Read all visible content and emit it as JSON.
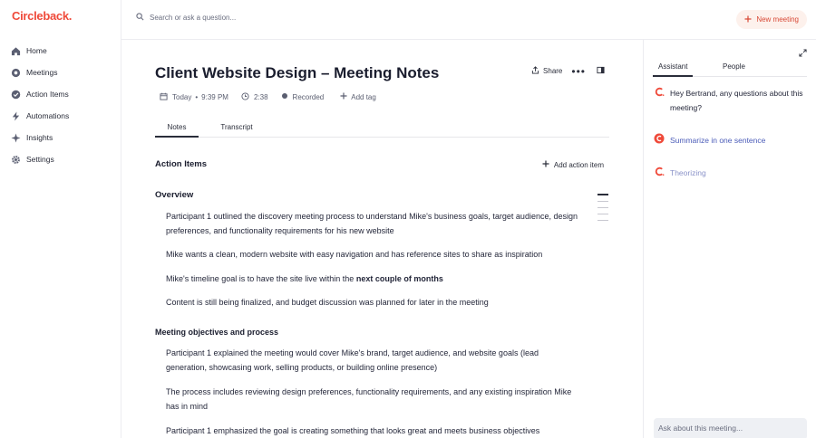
{
  "app": {
    "logo_text": "Circleback",
    "logo_dot": "."
  },
  "sidebar": {
    "items": [
      {
        "icon": "home-icon",
        "label": "Home"
      },
      {
        "icon": "meetings-icon",
        "label": "Meetings"
      },
      {
        "icon": "check-circle-icon",
        "label": "Action Items"
      },
      {
        "icon": "lightning-icon",
        "label": "Automations"
      },
      {
        "icon": "sparkle-icon",
        "label": "Insights"
      },
      {
        "icon": "gear-icon",
        "label": "Settings"
      }
    ]
  },
  "topbar": {
    "search_placeholder": "Search or ask a question...",
    "new_meeting_label": "New meeting"
  },
  "meeting": {
    "title": "Client Website Design – Meeting Notes",
    "share_label": "Share",
    "more_label": "•••",
    "date": "Today",
    "separator": "•",
    "time": "9:39 PM",
    "duration": "2:38",
    "recorded_label": "Recorded",
    "add_tag_label": "Add tag",
    "tabs": [
      {
        "label": "Notes"
      },
      {
        "label": "Transcript"
      }
    ],
    "action_items_header": "Action Items",
    "add_action_item_label": "Add action item",
    "overview_header": "Overview",
    "overview_paragraphs": [
      "Participant 1 outlined the discovery meeting process to understand Mike's business goals, target audience, design preferences, and functionality requirements for his new website",
      "Mike wants a clean, modern website with easy navigation and has reference sites to share as inspiration",
      "Content is still being finalized, and budget discussion was planned for later in the meeting"
    ],
    "timeline_prefix": "Mike's timeline goal is to have the site live within the ",
    "timeline_bold": "next couple of months",
    "objectives_header": "Meeting objectives and process",
    "objectives_paragraphs": [
      "Participant 1 explained the meeting would cover Mike's brand, target audience, and website goals (lead generation, showcasing work, selling products, or building online presence)",
      "The process includes reviewing design preferences, functionality requirements, and any existing inspiration Mike has in mind",
      "Participant 1 emphasized the goal is creating something that looks great and meets business objectives"
    ]
  },
  "panel": {
    "tabs": [
      {
        "label": "Assistant"
      },
      {
        "label": "People"
      }
    ],
    "greeting": "Hey Bertrand, any questions about this meeting?",
    "summarize_label": "Summarize in one sentence",
    "status_label": "Theorizing",
    "ask_placeholder": "Ask about this meeting..."
  },
  "colors": {
    "brand": "#ef4a3a",
    "accent_link": "#4a5bb8",
    "new_meeting_bg": "#fdf1ec"
  }
}
